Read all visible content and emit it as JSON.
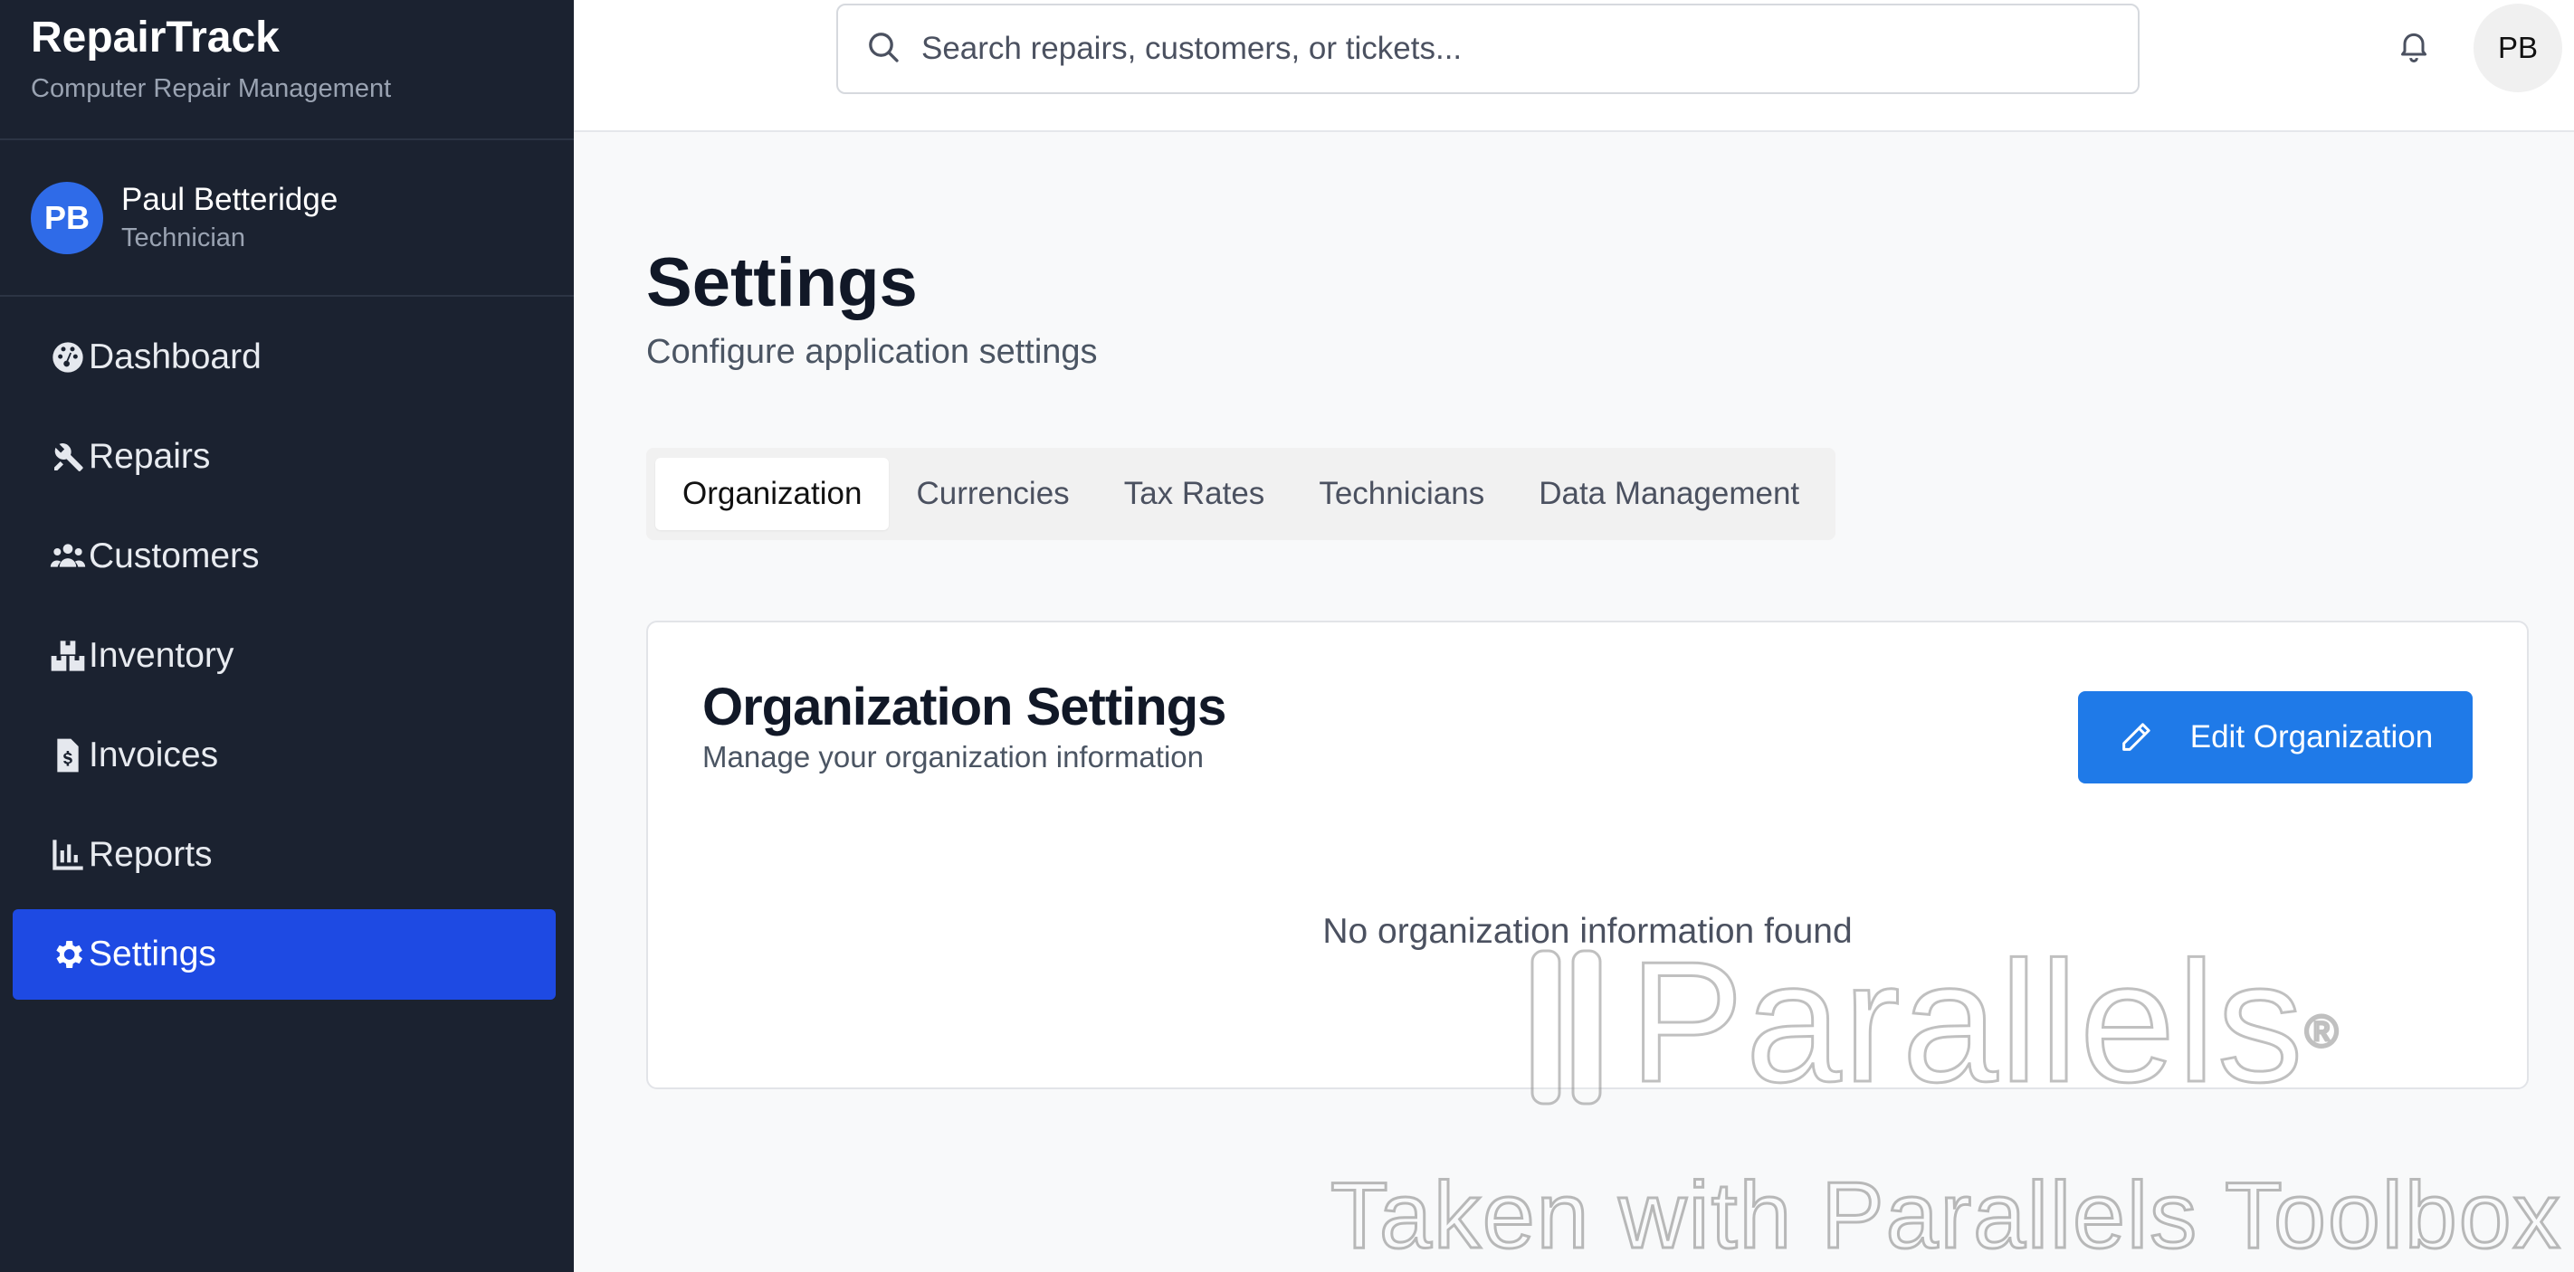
{
  "app": {
    "title": "RepairTrack",
    "subtitle": "Computer Repair Management"
  },
  "user": {
    "initials": "PB",
    "name": "Paul Betteridge",
    "role": "Technician"
  },
  "sidebar": {
    "items": [
      {
        "label": "Dashboard",
        "icon": "dashboard-icon",
        "active": false
      },
      {
        "label": "Repairs",
        "icon": "tools-icon",
        "active": false
      },
      {
        "label": "Customers",
        "icon": "users-icon",
        "active": false
      },
      {
        "label": "Inventory",
        "icon": "boxes-icon",
        "active": false
      },
      {
        "label": "Invoices",
        "icon": "invoice-icon",
        "active": false
      },
      {
        "label": "Reports",
        "icon": "chart-icon",
        "active": false
      },
      {
        "label": "Settings",
        "icon": "gear-icon",
        "active": true
      }
    ]
  },
  "topbar": {
    "search_placeholder": "Search repairs, customers, or tickets...",
    "avatar_initials": "PB"
  },
  "page": {
    "title": "Settings",
    "subtitle": "Configure application settings"
  },
  "tabs": [
    {
      "label": "Organization",
      "active": true
    },
    {
      "label": "Currencies",
      "active": false
    },
    {
      "label": "Tax Rates",
      "active": false
    },
    {
      "label": "Technicians",
      "active": false
    },
    {
      "label": "Data Management",
      "active": false
    }
  ],
  "card": {
    "title": "Organization Settings",
    "subtitle": "Manage your organization information",
    "edit_button": "Edit Organization",
    "empty_message": "No organization information found"
  },
  "watermark": {
    "logo": "Parallels",
    "registered": "®",
    "caption": "Taken with Parallels Toolbox"
  },
  "colors": {
    "sidebar_bg": "#1b2230",
    "active_nav": "#1e4ae3",
    "primary_button": "#1f7ae8",
    "avatar_blue": "#2f6be8"
  }
}
